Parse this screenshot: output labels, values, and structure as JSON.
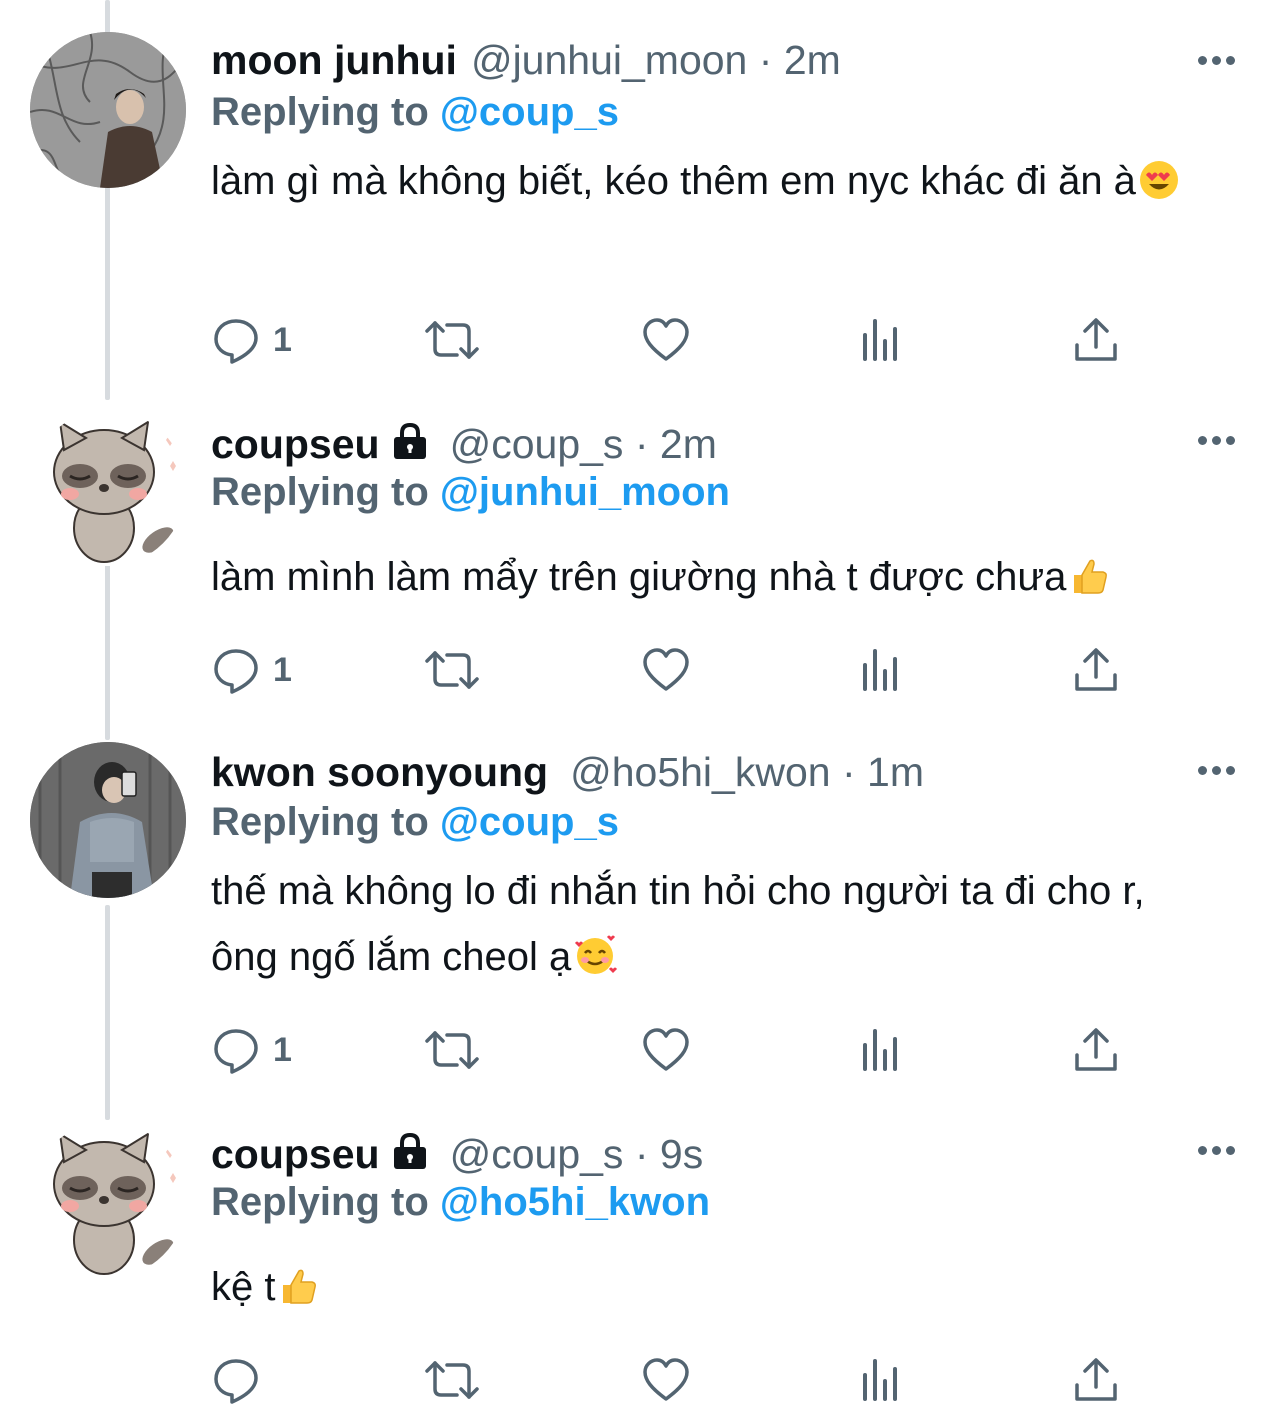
{
  "tweets": [
    {
      "name": "moon junhui",
      "locked": false,
      "handle": "@junhui_moon",
      "separator": "·",
      "time": "2m",
      "replying_label": "Replying to",
      "replying_to": "@coup_s",
      "text": "làm gì mà không biết, kéo thêm em nyc khác đi ăn à",
      "emoji": "heart-eyes-emoji",
      "reply_count": "1",
      "avatar": "photo-avatar-man-branches"
    },
    {
      "name": "coupseu",
      "locked": true,
      "handle": "@coup_s",
      "separator": "·",
      "time": "2m",
      "replying_label": "Replying to",
      "replying_to": "@junhui_moon",
      "text": "làm mình làm mẩy trên giường nhà t được chưa",
      "emoji": "thumbs-up-emoji",
      "reply_count": "1",
      "avatar": "raccoon-cartoon-avatar"
    },
    {
      "name": "kwon soonyoung",
      "locked": false,
      "handle": "@ho5hi_kwon",
      "separator": "·",
      "time": "1m",
      "replying_label": "Replying to",
      "replying_to": "@coup_s",
      "text": "thế mà không lo đi nhắn tin hỏi cho người ta đi cho r, ông ngố lắm cheol ạ",
      "emoji": "smiling-hearts-emoji",
      "reply_count": "1",
      "avatar": "photo-avatar-mirror-selfie"
    },
    {
      "name": "coupseu",
      "locked": true,
      "handle": "@coup_s",
      "separator": "·",
      "time": "9s",
      "replying_label": "Replying to",
      "replying_to": "@ho5hi_kwon",
      "text": "kệ t",
      "emoji": "thumbs-up-emoji",
      "reply_count": "",
      "avatar": "raccoon-cartoon-avatar"
    }
  ],
  "colors": {
    "accent": "#1d9bf0",
    "secondary_text": "#536471",
    "primary_text": "#0f1419",
    "thread_line": "#d7dbdf"
  }
}
